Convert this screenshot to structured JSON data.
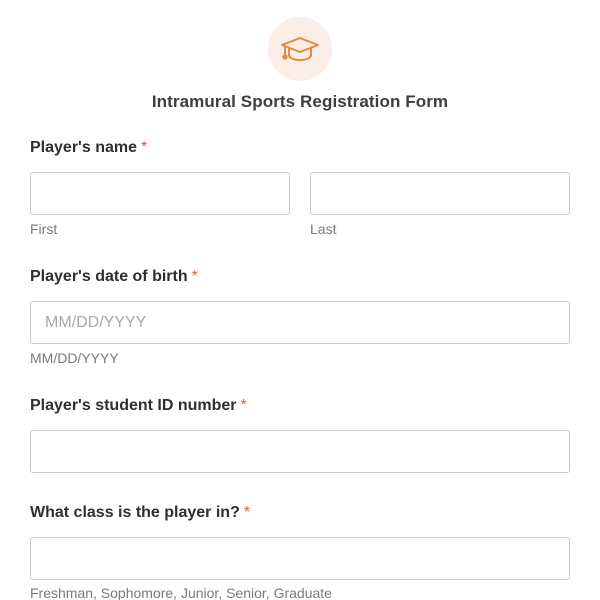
{
  "logo": {
    "icon": "graduation-cap-icon",
    "color": "#e8883a",
    "bg": "#fbeee6"
  },
  "form": {
    "title": "Intramural Sports Registration Form"
  },
  "fields": {
    "name": {
      "label": "Player's name",
      "required_marker": "*",
      "first": {
        "value": "",
        "sublabel": "First"
      },
      "last": {
        "value": "",
        "sublabel": "Last"
      }
    },
    "dob": {
      "label": "Player's date of birth",
      "required_marker": "*",
      "value": "",
      "placeholder": "MM/DD/YYYY",
      "sublabel": "MM/DD/YYYY"
    },
    "student_id": {
      "label": "Player's student ID number",
      "required_marker": "*",
      "value": ""
    },
    "class": {
      "label": "What class is the player in?",
      "required_marker": "*",
      "value": "",
      "sublabel": "Freshman, Sophomore, Junior, Senior, Graduate"
    }
  },
  "colors": {
    "required": "#e5553a",
    "border": "#c9c9c9"
  }
}
